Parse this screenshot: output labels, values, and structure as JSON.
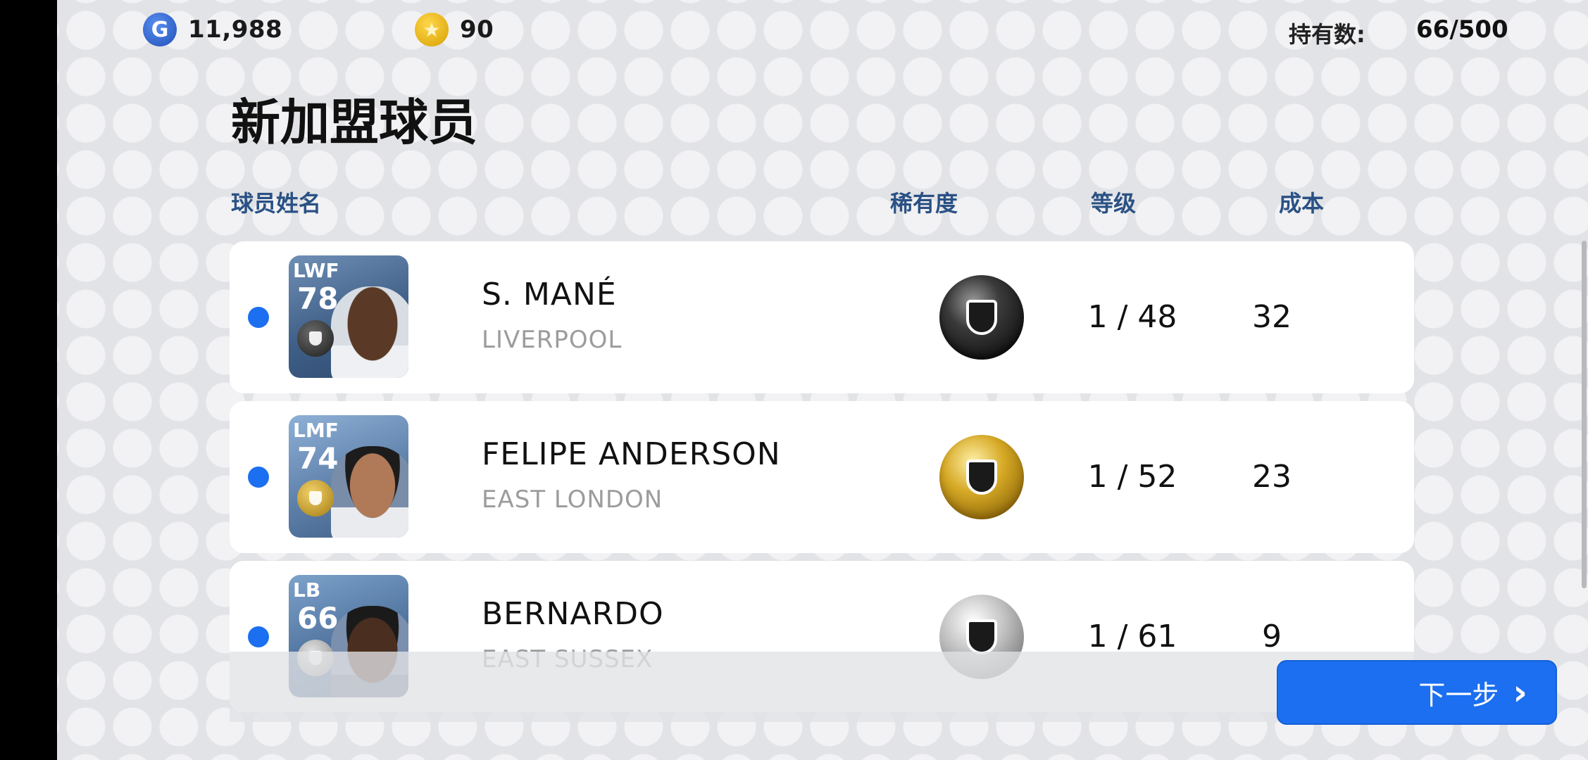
{
  "topbar": {
    "gp_icon": "G",
    "gp_amount": "11,988",
    "coin_icon": "★",
    "coin_amount": "90",
    "owned_label": "持有数:",
    "owned_value": "66/500"
  },
  "page": {
    "title": "新加盟球员",
    "col_name": "球员姓名",
    "col_rarity": "稀有度",
    "col_level": "等级",
    "col_cost": "成本"
  },
  "players": [
    {
      "position": "LWF",
      "rating": "78",
      "name": "S. MANÉ",
      "club": "LIVERPOOL",
      "rarity": "black",
      "level": "1 / 48",
      "cost": "32"
    },
    {
      "position": "LMF",
      "rating": "74",
      "name": "FELIPE ANDERSON",
      "club": "EAST LONDON",
      "rarity": "gold",
      "level": "1 / 52",
      "cost": "23"
    },
    {
      "position": "LB",
      "rating": "66",
      "name": "BERNARDO",
      "club": "EAST SUSSEX",
      "rarity": "silver",
      "level": "1 / 61",
      "cost": "9"
    }
  ],
  "footer": {
    "next_label": "下一步",
    "next_icon": "chevron-right-icon"
  },
  "colors": {
    "accent": "#1b6ff0",
    "header_text": "#2a5184",
    "background": "#e2e3e6"
  }
}
